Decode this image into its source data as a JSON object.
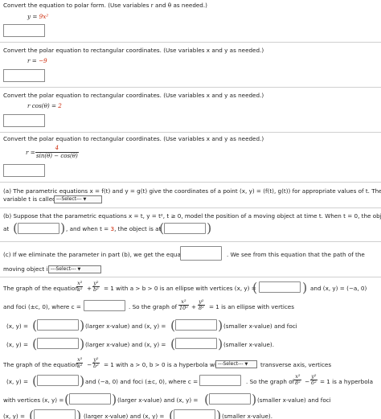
{
  "q1": {
    "prompt": "Convert the equation to polar form. (Use variables r and θ as needed.)",
    "eq_lhs": "y = ",
    "eq_rhs": "9x²"
  },
  "q2": {
    "prompt": "Convert the polar equation to rectangular coordinates. (Use variables x and y as needed.)",
    "eq_lhs": "r = ",
    "eq_rhs": "−9"
  },
  "q3": {
    "prompt": "Convert the polar equation to rectangular coordinates. (Use variables x and y as needed.)",
    "eq_lhs": "r cos(θ) = ",
    "eq_rhs": "2"
  },
  "q4": {
    "prompt": "Convert the polar equation to rectangular coordinates. (Use variables x and y as needed.)",
    "eq_lhs": "r = ",
    "frac_num": "4",
    "frac_den": "sin(θ) − cos(θ)"
  },
  "qa": {
    "line1": "(a) The parametric equations  x = f(t)  and  y = g(t)  give the coordinates of a point  (x, y) = (f(t), g(t))  for appropriate values of t. The",
    "line2": "variable t is called",
    "select": "---Select---"
  },
  "qb": {
    "line1": "(b) Suppose that the parametric equations  x = t, y = t², t ≥ 0,  model the position of a moving object at time t. When t = 0, the object is",
    "at": "at",
    "mid": ", and when t = ",
    "t_val": "3",
    "mid2": ", the object is at"
  },
  "qc": {
    "line1": "(c) If we eliminate the parameter in part (b), we get the equation",
    "line1b": ". We see from this equation that the path of the",
    "line2": "moving object is",
    "select": "---Select---"
  },
  "qd": {
    "intro": "The graph of the equation",
    "ellipse_frac1_num": "x²",
    "ellipse_frac1_den": "a²",
    "plus": "+",
    "ellipse_frac2_num": "y²",
    "ellipse_frac2_den": "b²",
    "cond": "= 1  with  a > b > 0  is an ellipse with vertices  (x, y) =",
    "and_vertex": "and  (x, y) = (−a, 0)",
    "foci": "and foci  (±c, 0),  where  c =",
    "so": ". So the graph of",
    "f1_num": "x²",
    "f1_den": "10²",
    "f2_num": "y²",
    "f2_den": "8²",
    "is_ellipse": "= 1  is an ellipse with vertices",
    "xy": "(x, y) =",
    "larger": "(larger x-value)  and  (x, y) =",
    "smaller_foci": "(smaller x-value)  and foci",
    "xy2": "(x, y) =",
    "larger2": "(larger x-value)  and  (x, y) =",
    "smaller2": "(smaller x-value)."
  },
  "qe": {
    "intro": "The graph of the equation",
    "h_frac1_num": "x²",
    "h_frac1_den": "a²",
    "minus": "−",
    "h_frac2_num": "y²",
    "h_frac2_den": "b²",
    "cond": "= 1  with  a > 0, b > 0  is a hyperbola with",
    "select": "---Select---",
    "transverse": "transverse axis, vertices",
    "xy": "(x, y) =",
    "and_foci": "and  (−a, 0)  and foci  (±c, 0),  where  c =",
    "so": ". So the graph of",
    "f1_num": "x²",
    "f1_den": "8²",
    "f2_num": "y²",
    "f2_den": "6²",
    "is_hyper": "= 1  is a hyperbola",
    "with_vertices": "with vertices  (x, y) =",
    "larger": "(larger x-value)  and  (x, y) =",
    "smaller_foci": "(smaller x-value)  and foci",
    "xy2": "(x, y) =",
    "larger2": "(larger x-value)  and  (x, y) =",
    "smaller2": "(smaller x-value)."
  }
}
